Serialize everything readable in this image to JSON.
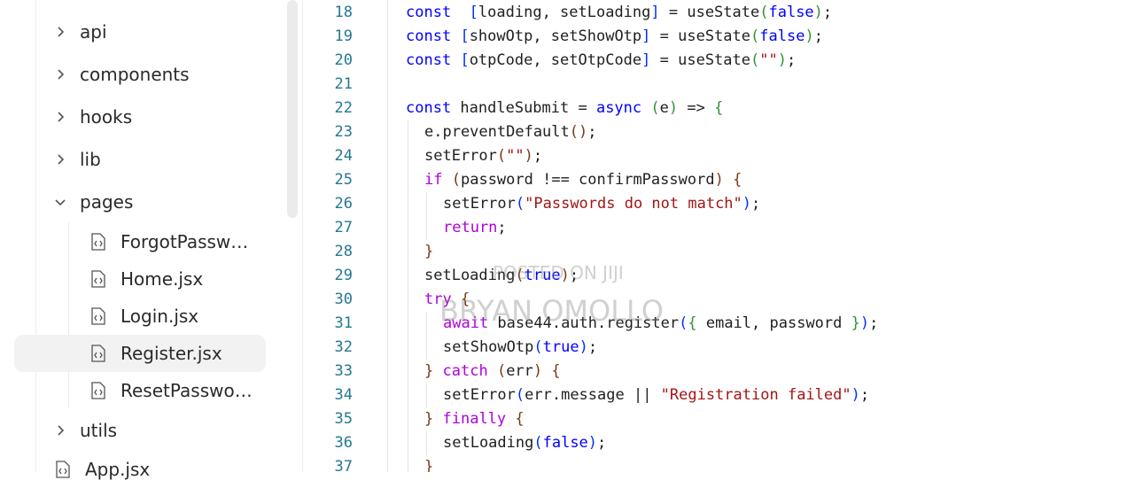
{
  "sidebar": {
    "folders": [
      {
        "label": "api",
        "expanded": false
      },
      {
        "label": "components",
        "expanded": false
      },
      {
        "label": "hooks",
        "expanded": false
      },
      {
        "label": "lib",
        "expanded": false
      },
      {
        "label": "pages",
        "expanded": true
      }
    ],
    "page_files": [
      {
        "label": "ForgotPassw…",
        "selected": false
      },
      {
        "label": "Home.jsx",
        "selected": false
      },
      {
        "label": "Login.jsx",
        "selected": false
      },
      {
        "label": "Register.jsx",
        "selected": true
      },
      {
        "label": "ResetPasswo…",
        "selected": false
      }
    ],
    "after_folders": [
      {
        "label": "utils",
        "expanded": false
      }
    ],
    "root_file": {
      "label": "App.jsx"
    }
  },
  "editor": {
    "lines": [
      {
        "num": "18",
        "indent": 0,
        "tokens": [
          [
            "kw",
            "const"
          ],
          [
            "",
            "  "
          ],
          [
            "b1",
            "["
          ],
          [
            "",
            "loading, setLoading"
          ],
          [
            "b1",
            "]"
          ],
          [
            "",
            " = useState"
          ],
          [
            "b2",
            "("
          ],
          [
            "bool",
            "false"
          ],
          [
            "b2",
            ")"
          ],
          [
            "",
            ";"
          ]
        ]
      },
      {
        "num": "19",
        "indent": 0,
        "tokens": [
          [
            "kw",
            "const"
          ],
          [
            "",
            " "
          ],
          [
            "b1",
            "["
          ],
          [
            "",
            "showOtp, setShowOtp"
          ],
          [
            "b1",
            "]"
          ],
          [
            "",
            " = useState"
          ],
          [
            "b2",
            "("
          ],
          [
            "bool",
            "false"
          ],
          [
            "b2",
            ")"
          ],
          [
            "",
            ";"
          ]
        ]
      },
      {
        "num": "20",
        "indent": 0,
        "tokens": [
          [
            "kw",
            "const"
          ],
          [
            "",
            " "
          ],
          [
            "b1",
            "["
          ],
          [
            "",
            "otpCode, setOtpCode"
          ],
          [
            "b1",
            "]"
          ],
          [
            "",
            " = useState"
          ],
          [
            "b2",
            "("
          ],
          [
            "str",
            "\"\""
          ],
          [
            "b2",
            ")"
          ],
          [
            "",
            ";"
          ]
        ]
      },
      {
        "num": "21",
        "indent": 0,
        "tokens": []
      },
      {
        "num": "22",
        "indent": 0,
        "tokens": [
          [
            "kw",
            "const"
          ],
          [
            "",
            " handleSubmit = "
          ],
          [
            "kw",
            "async"
          ],
          [
            "",
            " "
          ],
          [
            "b2",
            "("
          ],
          [
            "",
            "e"
          ],
          [
            "b2",
            ")"
          ],
          [
            "",
            " => "
          ],
          [
            "b2",
            "{"
          ]
        ]
      },
      {
        "num": "23",
        "indent": 1,
        "tokens": [
          [
            "",
            "e.preventDefault"
          ],
          [
            "b3",
            "()"
          ],
          [
            "",
            ";"
          ]
        ]
      },
      {
        "num": "24",
        "indent": 1,
        "tokens": [
          [
            "",
            "setError"
          ],
          [
            "b3",
            "("
          ],
          [
            "str",
            "\"\""
          ],
          [
            "b3",
            ")"
          ],
          [
            "",
            ";"
          ]
        ]
      },
      {
        "num": "25",
        "indent": 1,
        "tokens": [
          [
            "kw2",
            "if"
          ],
          [
            "",
            " "
          ],
          [
            "b3",
            "("
          ],
          [
            "",
            "password !== confirmPassword"
          ],
          [
            "b3",
            ")"
          ],
          [
            "",
            " "
          ],
          [
            "b3",
            "{"
          ]
        ]
      },
      {
        "num": "26",
        "indent": 2,
        "tokens": [
          [
            "",
            "setError"
          ],
          [
            "b1",
            "("
          ],
          [
            "str",
            "\"Passwords do not match\""
          ],
          [
            "b1",
            ")"
          ],
          [
            "",
            ";"
          ]
        ]
      },
      {
        "num": "27",
        "indent": 2,
        "tokens": [
          [
            "kw2",
            "return"
          ],
          [
            "",
            ";"
          ]
        ]
      },
      {
        "num": "28",
        "indent": 1,
        "tokens": [
          [
            "b3",
            "}"
          ]
        ]
      },
      {
        "num": "29",
        "indent": 1,
        "tokens": [
          [
            "",
            "setLoading"
          ],
          [
            "b3",
            "("
          ],
          [
            "bool",
            "true"
          ],
          [
            "b3",
            ")"
          ],
          [
            "",
            ";"
          ]
        ]
      },
      {
        "num": "30",
        "indent": 1,
        "tokens": [
          [
            "kw2",
            "try"
          ],
          [
            "",
            " "
          ],
          [
            "b3",
            "{"
          ]
        ]
      },
      {
        "num": "31",
        "indent": 2,
        "tokens": [
          [
            "kw2",
            "await"
          ],
          [
            "",
            " base44.auth.register"
          ],
          [
            "b1",
            "("
          ],
          [
            "b2",
            "{"
          ],
          [
            "",
            " email, password "
          ],
          [
            "b2",
            "}"
          ],
          [
            "b1",
            ")"
          ],
          [
            "",
            ";"
          ]
        ]
      },
      {
        "num": "32",
        "indent": 2,
        "tokens": [
          [
            "",
            "setShowOtp"
          ],
          [
            "b1",
            "("
          ],
          [
            "bool",
            "true"
          ],
          [
            "b1",
            ")"
          ],
          [
            "",
            ";"
          ]
        ]
      },
      {
        "num": "33",
        "indent": 1,
        "tokens": [
          [
            "b3",
            "}"
          ],
          [
            "",
            " "
          ],
          [
            "kw2",
            "catch"
          ],
          [
            "",
            " "
          ],
          [
            "b3",
            "("
          ],
          [
            "",
            "err"
          ],
          [
            "b3",
            ")"
          ],
          [
            "",
            " "
          ],
          [
            "b3",
            "{"
          ]
        ]
      },
      {
        "num": "34",
        "indent": 2,
        "tokens": [
          [
            "",
            "setError"
          ],
          [
            "b1",
            "("
          ],
          [
            "",
            "err.message || "
          ],
          [
            "str",
            "\"Registration failed\""
          ],
          [
            "b1",
            ")"
          ],
          [
            "",
            ";"
          ]
        ]
      },
      {
        "num": "35",
        "indent": 1,
        "tokens": [
          [
            "b3",
            "}"
          ],
          [
            "",
            " "
          ],
          [
            "kw2",
            "finally"
          ],
          [
            "",
            " "
          ],
          [
            "b3",
            "{"
          ]
        ]
      },
      {
        "num": "36",
        "indent": 2,
        "tokens": [
          [
            "",
            "setLoading"
          ],
          [
            "b1",
            "("
          ],
          [
            "bool",
            "false"
          ],
          [
            "b1",
            ")"
          ],
          [
            "",
            ";"
          ]
        ]
      },
      {
        "num": "37",
        "indent": 1,
        "tokens": [
          [
            "b3",
            "}"
          ]
        ]
      }
    ]
  },
  "watermark": {
    "line1": "POSTED ON JIJI",
    "line2": "BRYAN OMOLLO"
  },
  "colors": {
    "keyword": "#0000ff",
    "control": "#af00db",
    "string": "#a31515",
    "line_number": "#237893"
  },
  "icons": {
    "folder_collapsed": "chevron-right-icon",
    "folder_expanded": "chevron-down-icon",
    "file": "file-code-icon"
  }
}
